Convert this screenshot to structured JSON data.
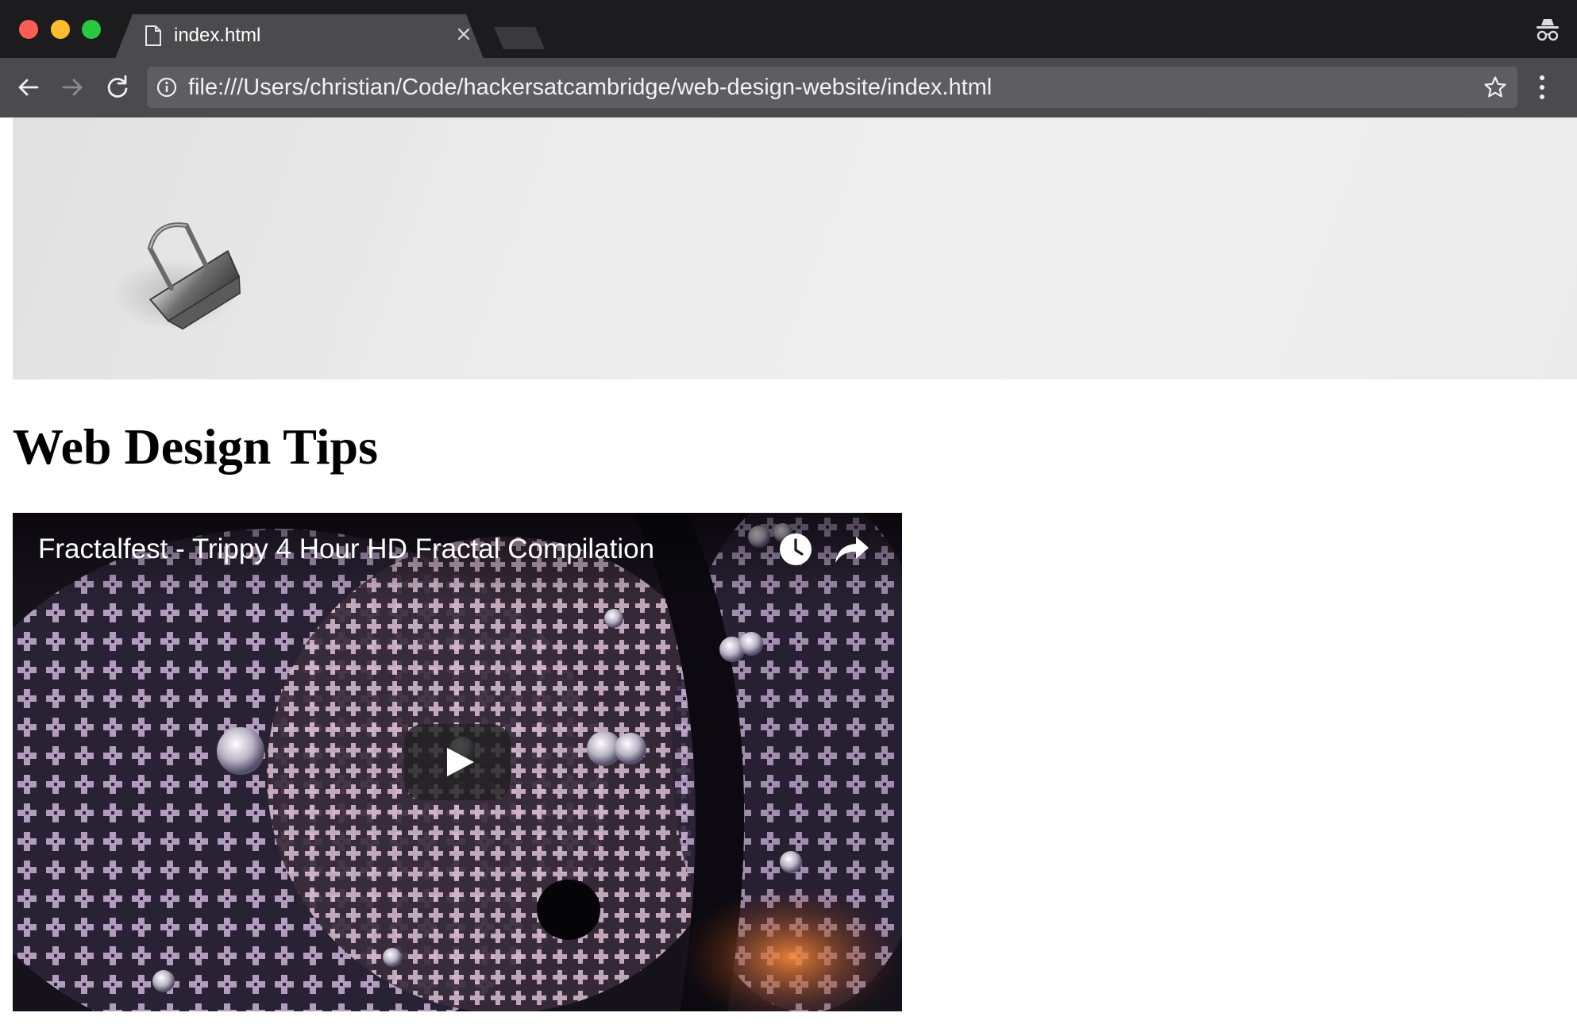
{
  "browser": {
    "tab": {
      "title": "index.html"
    },
    "address_bar": {
      "url": "file:///Users/christian/Code/hackersatcambridge/web-design-website/index.html"
    },
    "icons": {
      "page": "page-icon",
      "close": "close-icon",
      "incognito": "incognito-icon",
      "back": "back-arrow-icon",
      "forward": "forward-arrow-icon",
      "reload": "reload-icon",
      "info": "info-icon",
      "bookmark": "star-icon",
      "menu": "kebab-menu-icon"
    }
  },
  "page": {
    "heading": "Web Design Tips",
    "hero": {
      "image": "binder-clip-image"
    },
    "video": {
      "title": "Fractalfest - Trippy 4 Hour HD Fractal Compilation",
      "controls": [
        "watch-later-icon",
        "share-icon",
        "play-icon"
      ]
    }
  },
  "colors": {
    "tabstrip": "#1c1c1e",
    "toolbar": "#4b4b4e",
    "omnibox": "#5e5e61",
    "close_light": "#fc5d57",
    "minimize_light": "#fdbc2e",
    "zoom_light": "#28c840"
  }
}
